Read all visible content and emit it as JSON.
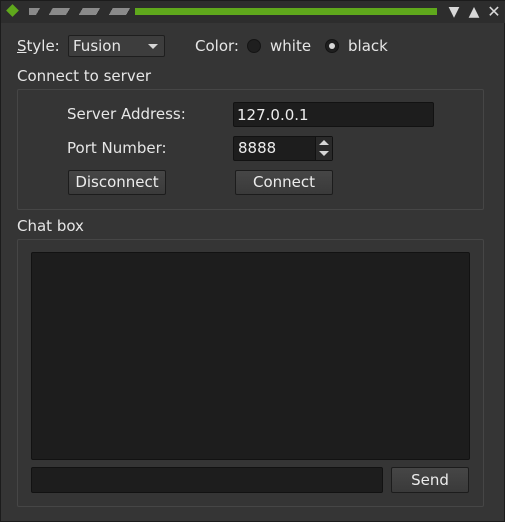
{
  "titlebar": {
    "accent_color": "#5fa81c",
    "minimize_icon": "▼",
    "maximize_icon": "▲",
    "close_icon": "✕"
  },
  "style_row": {
    "style_label_mnemonic": "S",
    "style_label_rest": "tyle:",
    "style_value": "Fusion",
    "color_label": "Color:",
    "options": [
      {
        "label": "white",
        "checked": false
      },
      {
        "label": "black",
        "checked": true
      }
    ]
  },
  "server": {
    "group_title": "Connect to server",
    "address_label": "Server Address:",
    "address_value": "127.0.0.1",
    "port_label": "Port Number:",
    "port_value": "8888",
    "disconnect_label": "Disconnect",
    "connect_label": "Connect"
  },
  "chat": {
    "group_title": "Chat box",
    "message_value": "",
    "send_label": "Send"
  }
}
